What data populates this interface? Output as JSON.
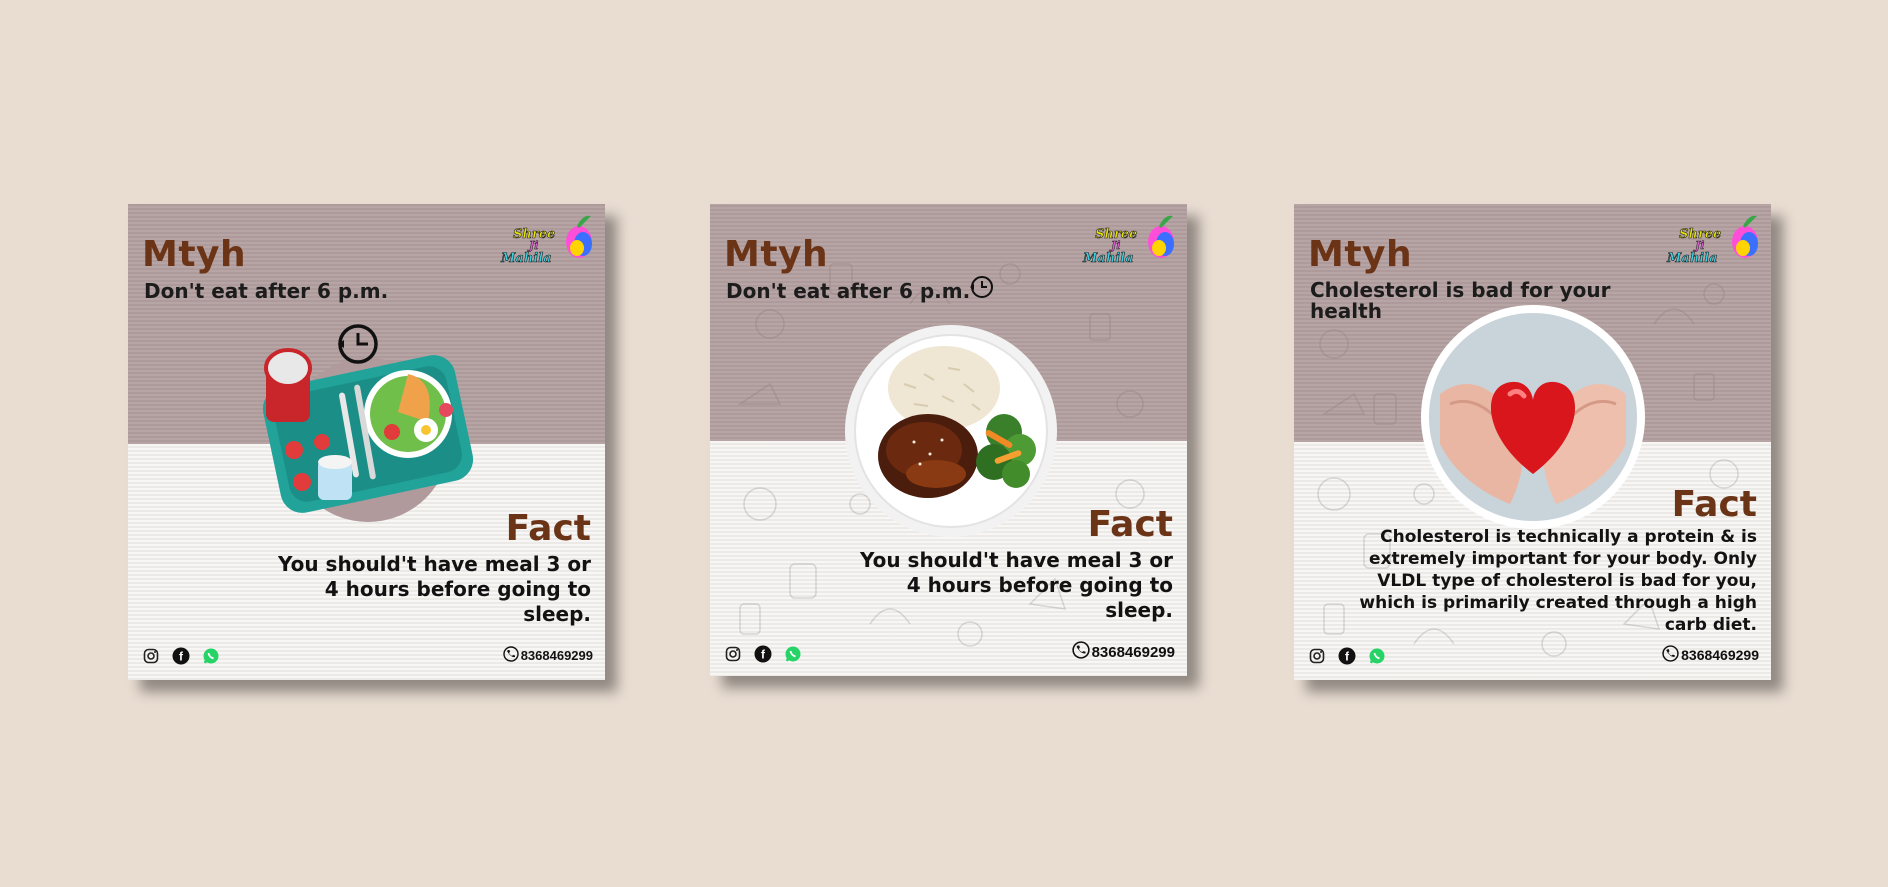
{
  "cards": [
    {
      "myth_label": "Mtyh",
      "myth_text": "Don't eat after 6 p.m.",
      "fact_label": "Fact",
      "fact_text": "You should't have meal 3 or 4 hours before going to sleep.",
      "phone": "8368469299",
      "image": "meal-tray-clock"
    },
    {
      "myth_label": "Mtyh",
      "myth_text": "Don't eat after 6 p.m.",
      "fact_label": "Fact",
      "fact_text": "You should't have meal 3 or 4 hours before going to sleep.",
      "phone": "8368469299",
      "image": "rice-chicken-broccoli-plate"
    },
    {
      "myth_label": "Mtyh",
      "myth_text": "Cholesterol is bad for your health",
      "fact_label": "Fact",
      "fact_text": "Cholesterol is technically a protein & is extremely important for your body. Only VLDL type of cholesterol is bad for you, which is primarily created through a high carb diet.",
      "phone": "8368469299",
      "image": "hands-holding-heart"
    }
  ],
  "logo": {
    "line1": "Shree",
    "line2": "Ji",
    "line3": "Mahila"
  },
  "social_icons": [
    "instagram-icon",
    "facebook-icon",
    "whatsapp-icon"
  ],
  "colors": {
    "background": "#e9ddd2",
    "heading_brown": "#6b3417",
    "top_band": "#b39f9f",
    "whatsapp": "#25d366"
  }
}
